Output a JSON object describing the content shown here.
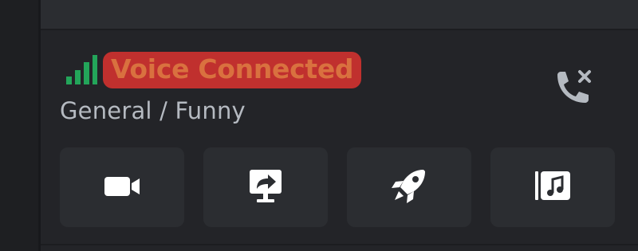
{
  "voice": {
    "status": "Voice Connected",
    "channel": "General / Funny"
  },
  "icons": {
    "signal": "signal-strength-icon",
    "disconnect": "phone-disconnect-icon",
    "camera": "camera-icon",
    "screenshare": "screen-share-icon",
    "activity": "rocket-icon",
    "soundboard": "soundboard-icon"
  },
  "colors": {
    "signal": "#23a55a",
    "status_text": "#d9713f",
    "status_highlight": "#c0302e",
    "icon": "#ffffff",
    "disconnect_icon": "#b5bac1"
  }
}
